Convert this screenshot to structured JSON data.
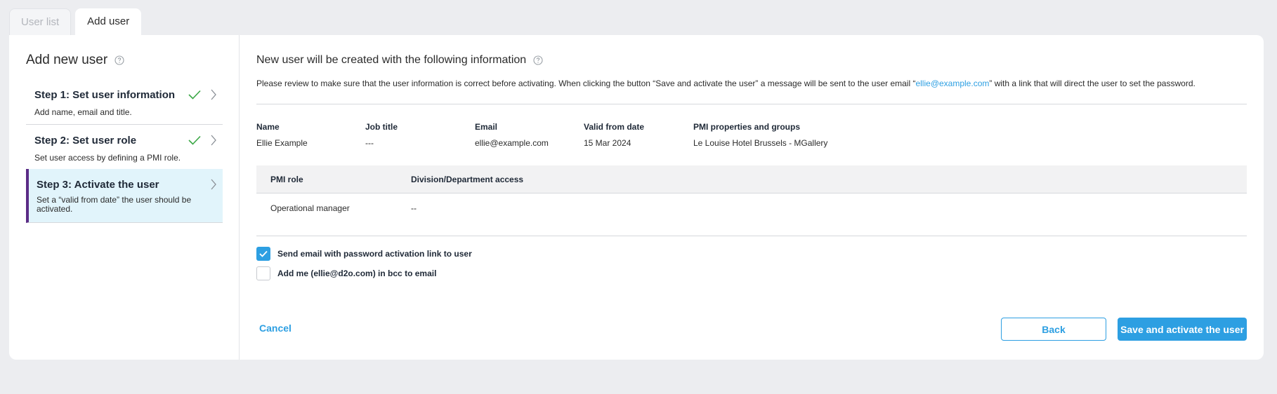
{
  "tabs": [
    {
      "label": "User list",
      "active": false
    },
    {
      "label": "Add user",
      "active": true
    }
  ],
  "left": {
    "title": "Add new user",
    "steps": [
      {
        "title": "Step 1: Set user information",
        "description": "Add name, email and title.",
        "completed": true
      },
      {
        "title": "Step 2: Set user role",
        "description": "Set user access by defining a PMI role.",
        "completed": true
      },
      {
        "title": "Step 3: Activate the user",
        "description": "Set a “valid from date” the user should be activated.",
        "completed": false,
        "active": true
      }
    ]
  },
  "main": {
    "title": "New user will be created with the following information",
    "description_before": "Please review to make sure that the user information is correct before activating. When clicking the button “Save and activate the user” a message will be sent to the user email “",
    "description_email": "ellie@example.com",
    "description_after": "” with a link that will direct the user to set the password.",
    "info": {
      "name_label": "Name",
      "name_value": "Ellie Example",
      "job_label": "Job title",
      "job_value": "---",
      "email_label": "Email",
      "email_value": "ellie@example.com",
      "valid_label": "Valid from date",
      "valid_value": "15 Mar 2024",
      "pmi_label": "PMI properties and groups",
      "pmi_value": "Le Louise Hotel Brussels - MGallery"
    },
    "roles_table": {
      "headers": [
        "PMI role",
        "Division/Department access"
      ],
      "rows": [
        [
          "Operational manager",
          "--"
        ]
      ]
    },
    "checkboxes": [
      {
        "label": "Send email with password activation link to user",
        "checked": true
      },
      {
        "label": "Add me (ellie@d2o.com) in bcc to email",
        "checked": false
      }
    ],
    "buttons": {
      "cancel": "Cancel",
      "back": "Back",
      "save": "Save and activate the user"
    }
  },
  "colors": {
    "accent": "#2d9fe2",
    "active_step_bg": "#e1f4fb",
    "active_step_border": "#5b2c86",
    "check_green": "#3aa745"
  }
}
